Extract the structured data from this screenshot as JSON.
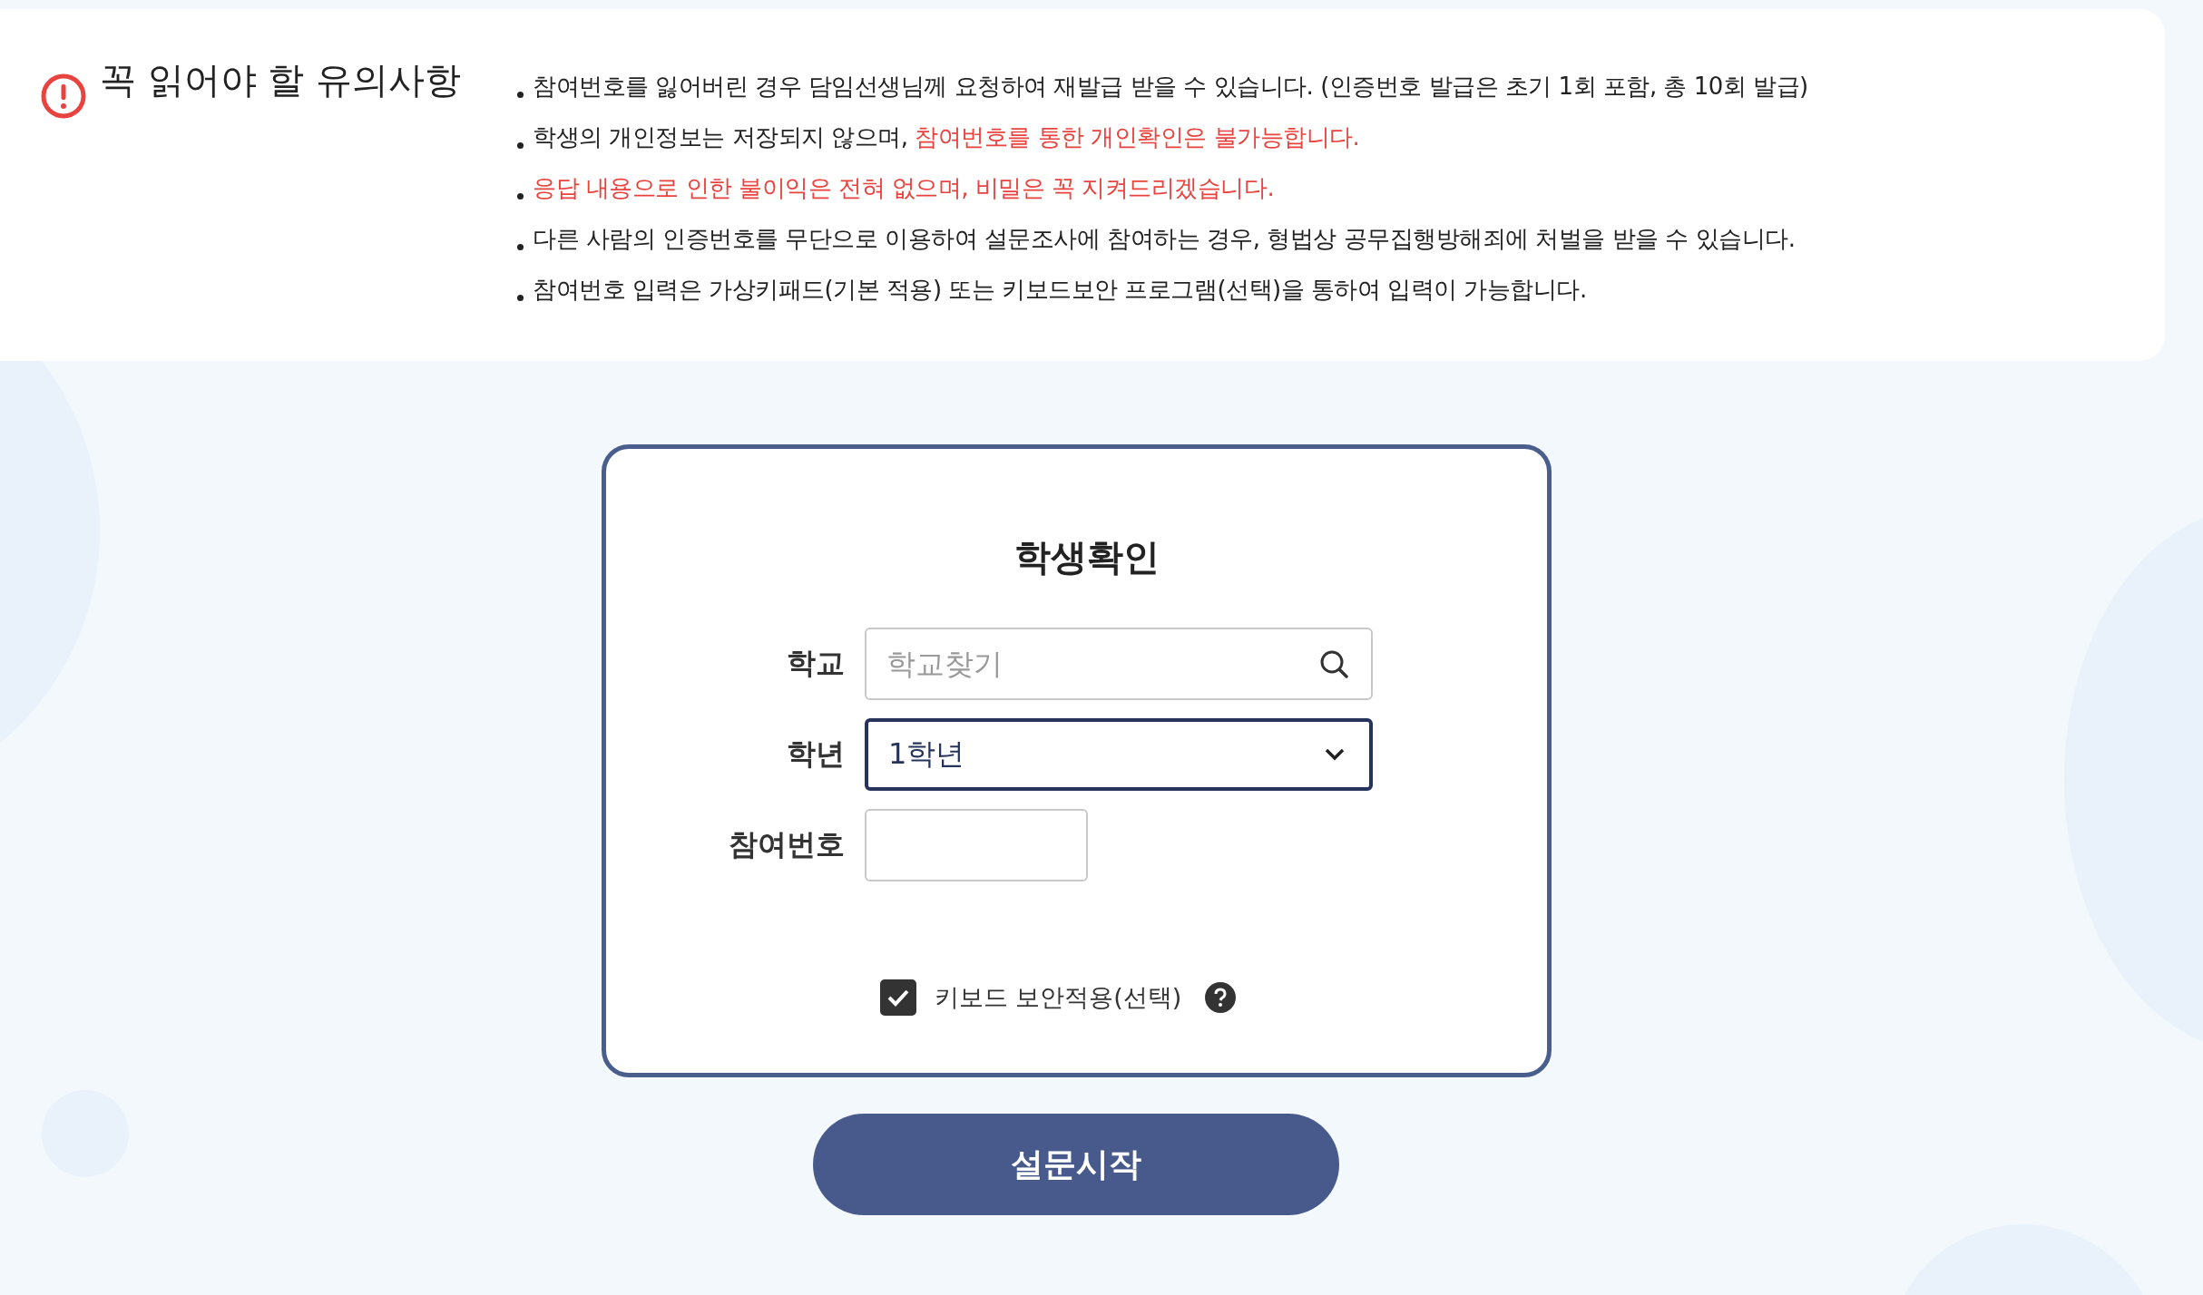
{
  "notice": {
    "title": "꼭 읽어야 할 유의사항",
    "items": [
      {
        "parts": [
          {
            "text": "참여번호를 잃어버린 경우 담임선생님께 요청하여 재발급 받을 수 있습니다. (인증번호 발급은 초기 1회  포함, 총 10회 발급)",
            "highlight": false
          }
        ]
      },
      {
        "parts": [
          {
            "text": "학생의 개인정보는 저장되지 않으며, ",
            "highlight": false
          },
          {
            "text": "참여번호를 통한 개인확인은 불가능합니다.",
            "highlight": true
          }
        ]
      },
      {
        "parts": [
          {
            "text": "응답 내용으로 인한 불이익은 전혀 없으며, 비밀은 꼭 지켜드리겠습니다.",
            "highlight": true
          }
        ]
      },
      {
        "parts": [
          {
            "text": "다른 사람의 인증번호를 무단으로 이용하여 설문조사에 참여하는 경우, 형법상 공무집행방해죄에 처벌을 받을 수 있습니다.",
            "highlight": false
          }
        ]
      },
      {
        "parts": [
          {
            "text": "참여번호 입력은 가상키패드(기본 적용) 또는 키보드보안 프로그램(선택)을 통하여 입력이 가능합니다.",
            "highlight": false
          }
        ]
      }
    ]
  },
  "form": {
    "title": "학생확인",
    "school": {
      "label": "학교",
      "placeholder": "학교찾기"
    },
    "grade": {
      "label": "학년",
      "value": "1학년"
    },
    "number": {
      "label": "참여번호"
    },
    "keyboard_security": {
      "label": "키보드 보안적용(선택)",
      "checked": true
    }
  },
  "start_button": "설문시작"
}
